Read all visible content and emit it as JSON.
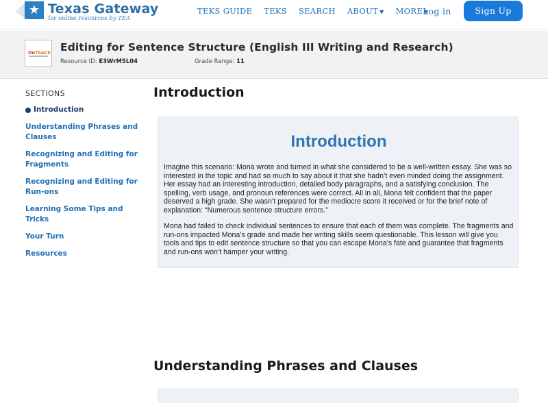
{
  "brand": {
    "title": "Texas Gateway",
    "subtitle_prefix": "for online resources ",
    "subtitle_by": "by TEA"
  },
  "nav": {
    "items": [
      {
        "label": "TEKS GUIDE",
        "has_caret": false
      },
      {
        "label": "TEKS",
        "has_caret": false
      },
      {
        "label": "SEARCH",
        "has_caret": false
      },
      {
        "label": "ABOUT",
        "has_caret": true
      },
      {
        "label": "MORE",
        "has_caret": true
      }
    ],
    "login": "Log in",
    "signup": "Sign Up"
  },
  "resource": {
    "logo_text_on": "On",
    "logo_text_track": "TRACK",
    "title": "Editing for Sentence Structure (English III Writing and Research)",
    "id_label": "Resource ID: ",
    "id_value": "E3WrM5L04",
    "grade_label": "Grade Range: ",
    "grade_value": "11"
  },
  "sidebar": {
    "heading": "SECTIONS",
    "items": [
      {
        "label": "Introduction",
        "active": true
      },
      {
        "label": "Understanding Phrases and Clauses",
        "active": false
      },
      {
        "label": "Recognizing and Editing for Fragments",
        "active": false
      },
      {
        "label": "Recognizing and Editing for Run-ons",
        "active": false
      },
      {
        "label": "Learning Some Tips and Tricks",
        "active": false
      },
      {
        "label": "Your Turn",
        "active": false
      },
      {
        "label": "Resources",
        "active": false
      }
    ]
  },
  "main": {
    "section1_heading": "Introduction",
    "card_title": "Introduction",
    "paragraph1": "Imagine this scenario: Mona wrote and turned in what she considered to be a well-written essay. She was so interested in the topic and had so much to say about it that she hadn’t even minded doing the assignment. Her essay had an interesting introduction, detailed body paragraphs, and a satisfying conclusion. The spelling, verb usage, and pronoun references were correct. All in all, Mona felt confident that the paper deserved a high grade. She wasn’t prepared for the mediocre score it received or for the brief note of explanation: “Numerous sentence structure errors.”",
    "paragraph2": "Mona had failed to check individual sentences to ensure that each of them was complete. The fragments and run-ons impacted Mona’s grade and made her writing skills seem questionable. This lesson will give you tools and tips to edit sentence structure so that you can escape Mona’s fate and guarantee that fragments and run-ons won’t hamper your writing.",
    "section2_heading": "Understanding Phrases and Clauses"
  },
  "colors": {
    "accent": "#1f6fb7",
    "button": "#1a7ad9",
    "card_bg": "#eef2f7",
    "card_title": "#2f75b5"
  }
}
